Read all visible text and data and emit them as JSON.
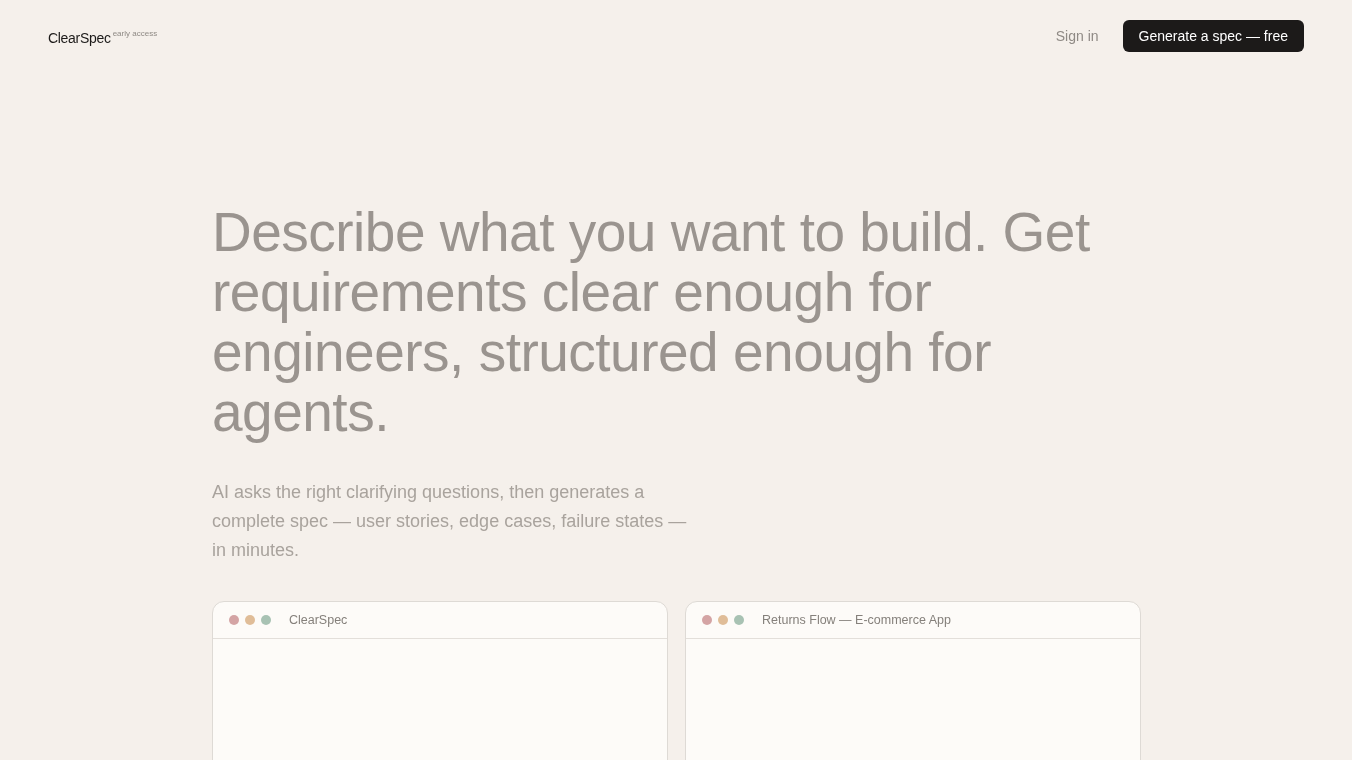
{
  "header": {
    "logo": "ClearSpec",
    "badge": "early access",
    "sign_in": "Sign in",
    "cta": "Generate a spec — free"
  },
  "hero": {
    "headline": "Describe what you want to build. Get requirements clear enough for engineers, structured enough for agents.",
    "subtext": "AI asks the right clarifying questions, then generates a complete spec — user stories, edge cases, failure states — in minutes."
  },
  "windows": [
    {
      "title": "ClearSpec"
    },
    {
      "title": "Returns Flow — E-commerce App"
    }
  ]
}
